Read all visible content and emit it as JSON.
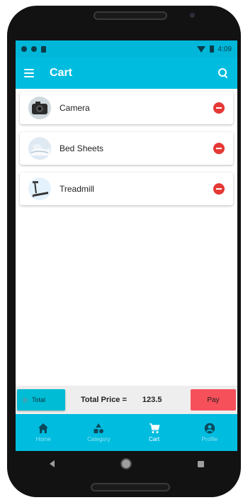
{
  "status_bar": {
    "time": "4:09"
  },
  "app_bar": {
    "title": "Cart"
  },
  "cart": {
    "items": [
      {
        "name": "Camera"
      },
      {
        "name": "Bed Sheets"
      },
      {
        "name": "Treadmill"
      }
    ]
  },
  "summary": {
    "total_button_label": "Total",
    "total_price_label": "Total Price =",
    "total_price_value": "123.5",
    "pay_button_label": "Pay"
  },
  "bottom_nav": {
    "items": [
      {
        "label": "Home",
        "icon": "home-icon",
        "active": false
      },
      {
        "label": "Category",
        "icon": "category-icon",
        "active": false
      },
      {
        "label": "Cart",
        "icon": "cart-icon",
        "active": true
      },
      {
        "label": "Profile",
        "icon": "profile-icon",
        "active": false
      }
    ]
  },
  "colors": {
    "primary": "#00bcdf",
    "pay": "#f6505a",
    "remove": "#e53935",
    "nav_inactive": "#8de3f2"
  }
}
